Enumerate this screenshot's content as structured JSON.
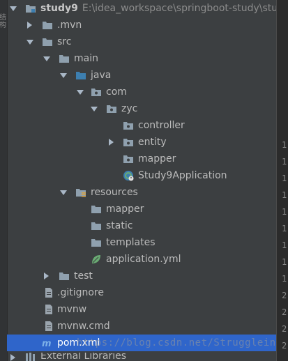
{
  "side_label": "结构",
  "project": {
    "name": "study9",
    "path": "E:\\idea_workspace\\springboot-study\\study"
  },
  "tree": [
    {
      "label": "study9",
      "kind": "module",
      "expanded": true
    },
    {
      "label": ".mvn",
      "kind": "folder",
      "expanded": false
    },
    {
      "label": "src",
      "kind": "folder",
      "expanded": true
    },
    {
      "label": "main",
      "kind": "folder",
      "expanded": true
    },
    {
      "label": "java",
      "kind": "source-folder",
      "expanded": true
    },
    {
      "label": "com",
      "kind": "package",
      "expanded": true
    },
    {
      "label": "zyc",
      "kind": "package",
      "expanded": true
    },
    {
      "label": "controller",
      "kind": "package"
    },
    {
      "label": "entity",
      "kind": "package",
      "expanded": false
    },
    {
      "label": "mapper",
      "kind": "package"
    },
    {
      "label": "Study9Application",
      "kind": "spring-class"
    },
    {
      "label": "resources",
      "kind": "resources-folder",
      "expanded": true
    },
    {
      "label": "mapper",
      "kind": "folder"
    },
    {
      "label": "static",
      "kind": "folder"
    },
    {
      "label": "templates",
      "kind": "folder"
    },
    {
      "label": "application.yml",
      "kind": "spring-yml"
    },
    {
      "label": "test",
      "kind": "folder",
      "expanded": false
    },
    {
      "label": ".gitignore",
      "kind": "file"
    },
    {
      "label": "mvnw",
      "kind": "file"
    },
    {
      "label": "mvnw.cmd",
      "kind": "file"
    },
    {
      "label": "pom.xml",
      "kind": "maven",
      "selected": true
    },
    {
      "label": "External Libraries",
      "kind": "libraries",
      "expanded": false
    }
  ],
  "gutter_numbers": [
    "1",
    "1",
    "1",
    "1",
    "1",
    "1",
    "1",
    "1",
    "1",
    "2",
    "2",
    "2",
    "2"
  ],
  "watermark": "https://blog.csdn.net/Strugglein",
  "colors": {
    "background": "#3c3f41",
    "selection": "#2f65ca",
    "folder": "#8fa0ae",
    "source_folder": "#3d7fb0",
    "spring": "#6aab73"
  }
}
